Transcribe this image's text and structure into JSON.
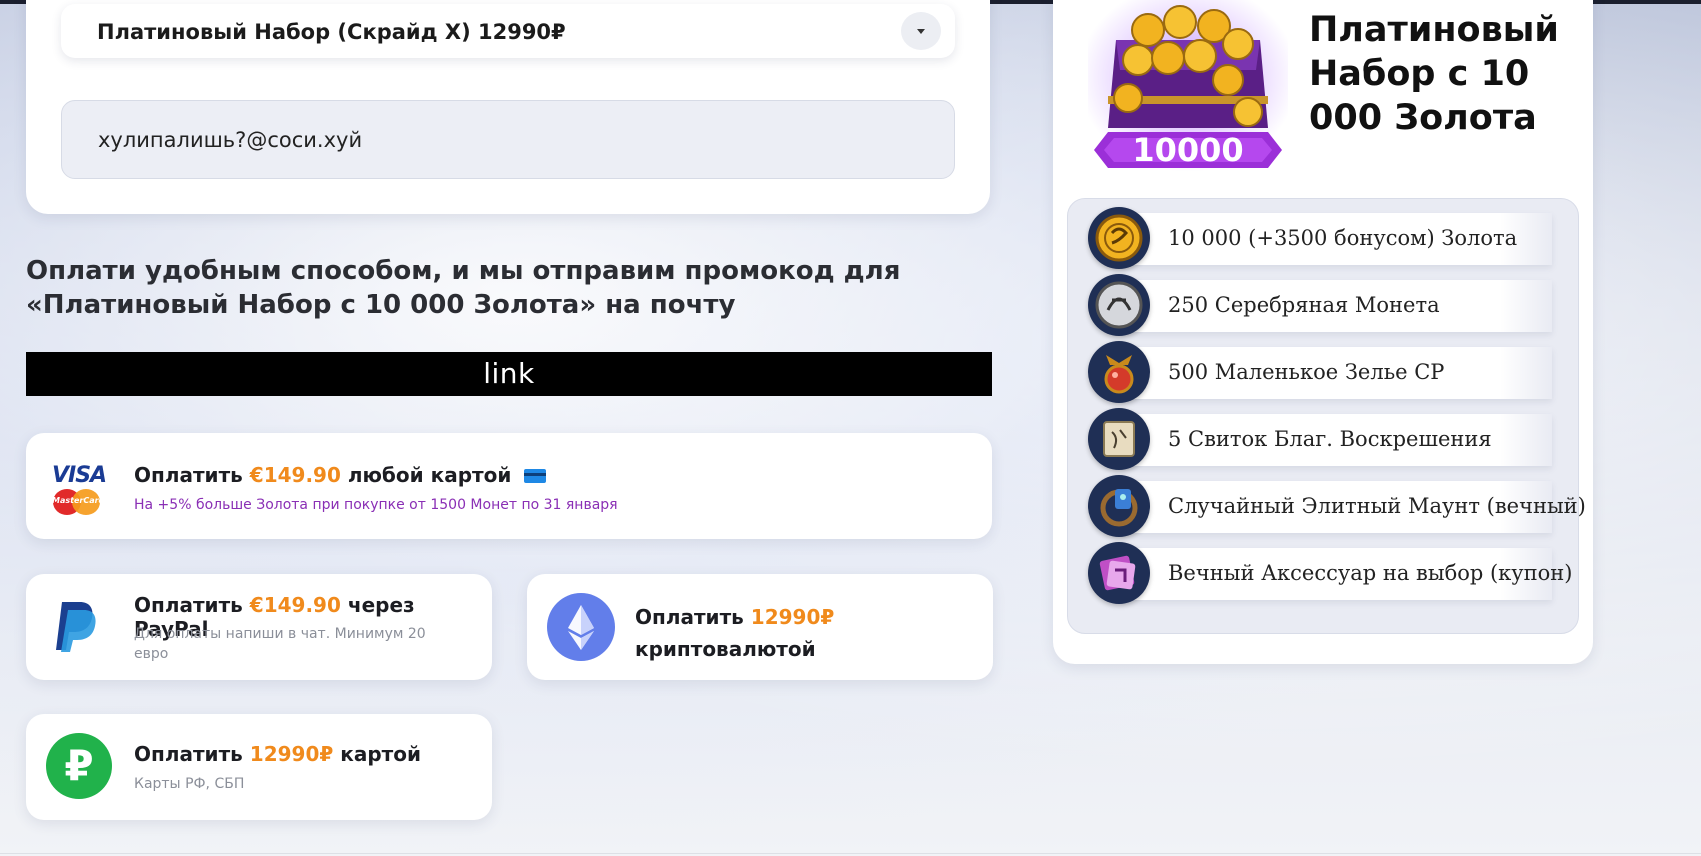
{
  "form": {
    "product_select": "Платиновый Набор (Скрайд X) 12990₽",
    "email_value": "хулипалишь?@соси.хуй"
  },
  "heading": {
    "line1": "Оплати удобным способом, и мы отправим промокод для",
    "line2": "«Платиновый Набор с 10 000 Золота» на почту"
  },
  "link_button": "link",
  "payments": {
    "card": {
      "pay": "Оплатить",
      "price": "€149.90",
      "rest": "любой картой",
      "note": "На +5% больше Золота при покупке от 1500 Монет по 31 января",
      "logo_visa": "VISA",
      "logo_mc": "MasterCard"
    },
    "paypal": {
      "pay": "Оплатить",
      "price": "€149.90",
      "rest": "через PayPal",
      "note": "Для оплаты напиши в чат. Минимум 20 евро"
    },
    "crypto": {
      "pay": "Оплатить",
      "price": "12990₽",
      "rest": "криптовалютой"
    },
    "rub": {
      "pay": "Оплатить",
      "price": "12990₽",
      "rest": "картой",
      "note": "Карты РФ, СБП",
      "symbol": "₽"
    }
  },
  "product": {
    "title": "Платиновый Набор с 10 000 Золота",
    "badge": "10000",
    "items": [
      {
        "label": "10 000 (+3500 бонусом) Золота",
        "icon": "gold-coin-icon"
      },
      {
        "label": "250 Серебряная Монета",
        "icon": "silver-coin-icon"
      },
      {
        "label": "500 Маленькое Зелье СР",
        "icon": "potion-icon"
      },
      {
        "label": "5 Свиток Благ. Воскрешения",
        "icon": "scroll-icon"
      },
      {
        "label": "Случайный Элитный Маунт (вечный)",
        "icon": "mount-icon"
      },
      {
        "label": "Вечный Аксессуар на выбор (купон)",
        "icon": "coupon-icon"
      }
    ]
  },
  "colors": {
    "accent_price": "#f08a1c",
    "promo_note": "#8a2fb5",
    "eth": "#627eea",
    "rub": "#21b24b"
  }
}
